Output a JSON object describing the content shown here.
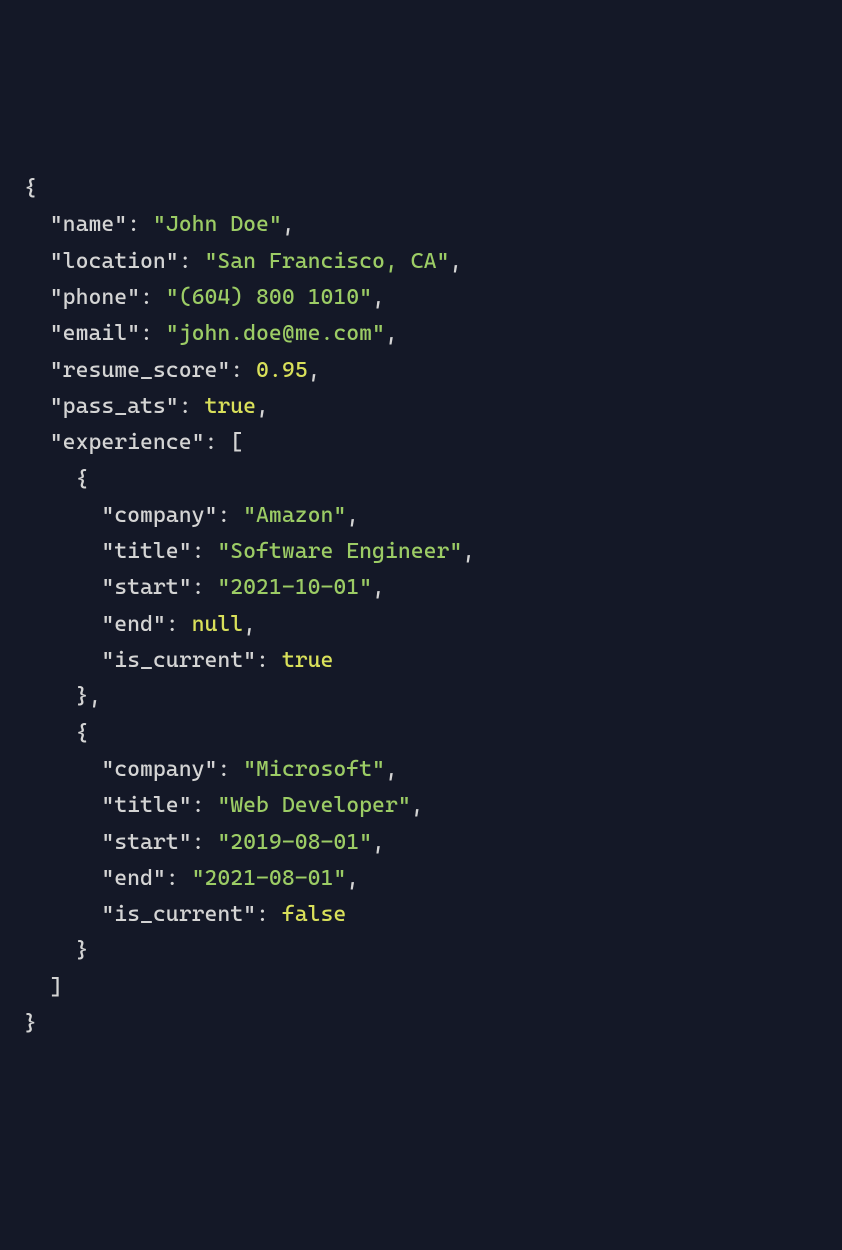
{
  "json": {
    "name_key": "\"name\"",
    "name_val": "\"John Doe\"",
    "location_key": "\"location\"",
    "location_val": "\"San Francisco, CA\"",
    "phone_key": "\"phone\"",
    "phone_val": "\"(604) 800 1010\"",
    "email_key": "\"email\"",
    "email_val": "\"john.doe@me.com\"",
    "resume_score_key": "\"resume_score\"",
    "resume_score_val": "0.95",
    "pass_ats_key": "\"pass_ats\"",
    "pass_ats_val": "true",
    "experience_key": "\"experience\"",
    "exp0_company_key": "\"company\"",
    "exp0_company_val": "\"Amazon\"",
    "exp0_title_key": "\"title\"",
    "exp0_title_val": "\"Software Engineer\"",
    "exp0_start_key": "\"start\"",
    "exp0_start_val": "\"2021-10-01\"",
    "exp0_end_key": "\"end\"",
    "exp0_end_val": "null",
    "exp0_iscurrent_key": "\"is_current\"",
    "exp0_iscurrent_val": "true",
    "exp1_company_key": "\"company\"",
    "exp1_company_val": "\"Microsoft\"",
    "exp1_title_key": "\"title\"",
    "exp1_title_val": "\"Web Developer\"",
    "exp1_start_key": "\"start\"",
    "exp1_start_val": "\"2019-08-01\"",
    "exp1_end_key": "\"end\"",
    "exp1_end_val": "\"2021-08-01\"",
    "exp1_iscurrent_key": "\"is_current\"",
    "exp1_iscurrent_val": "false"
  }
}
